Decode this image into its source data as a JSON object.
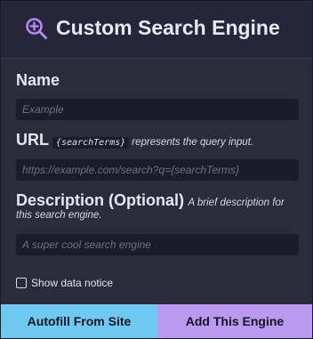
{
  "header": {
    "title": "Custom Search Engine",
    "icon": "search-plus-icon",
    "icon_color": "#b487f2"
  },
  "form": {
    "name": {
      "label": "Name",
      "placeholder": "Example",
      "value": ""
    },
    "url": {
      "label": "URL",
      "code": "{searchTerms}",
      "hint": "represents the query input.",
      "placeholder": "https://example.com/search?q={searchTerms}",
      "value": ""
    },
    "description": {
      "label": "Description (Optional)",
      "hint_line1": "A brief description for",
      "hint_line2": "this search engine.",
      "placeholder": "A super cool search engine",
      "value": ""
    },
    "data_notice": {
      "label": "Show data notice",
      "checked": false
    }
  },
  "buttons": {
    "autofill": {
      "label": "Autofill From Site",
      "color": "#6fc8ef"
    },
    "add": {
      "label": "Add This Engine",
      "color": "#b99af0"
    }
  }
}
